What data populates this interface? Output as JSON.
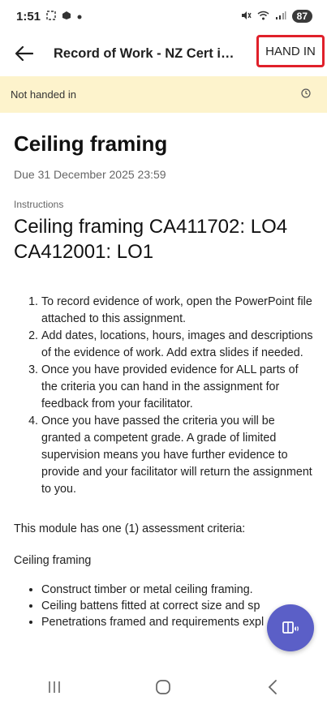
{
  "status_bar": {
    "time": "1:51",
    "battery": "87",
    "icons": [
      "screenshot-icon",
      "cloud-icon",
      "dot-icon",
      "mute-icon",
      "wifi-icon",
      "signal-icon"
    ]
  },
  "app_bar": {
    "title": "Record of Work - NZ Cert in Ca...",
    "hand_in_label": "HAND IN",
    "highlight_color": "#e0202a"
  },
  "banner": {
    "status": "Not handed in",
    "background": "#fdf3cc"
  },
  "assignment": {
    "title": "Ceiling framing",
    "due": "Due 31 December 2025 23:59",
    "instructions_label": "Instructions",
    "instructions_heading": "Ceiling framing CA411702: LO4 CA412001: LO1",
    "steps": [
      "To record evidence of work, open the PowerPoint file attached to this assignment.",
      "Add dates, locations, hours, images and descriptions of the evidence of work. Add extra slides if needed.",
      "Once you have provided evidence for ALL parts of the criteria you can hand in the assignment for feedback from your facilitator.",
      "Once you have passed the criteria you will be granted a competent grade. A grade of limited supervision means you have further evidence to provide and your facilitator will return the assignment to you."
    ],
    "module_text": "This module has one (1) assessment criteria:",
    "criteria_title": "Ceiling framing",
    "criteria": [
      "Construct timber or metal ceiling framing.",
      "Ceiling battens fitted at correct size and sp",
      "Penetrations framed and requirements expl"
    ]
  },
  "fab": {
    "icon": "immersive-reader-icon",
    "color": "#5b5fc7"
  },
  "nav_bar": {
    "icons": [
      "recents-icon",
      "home-icon",
      "back-nav-icon"
    ]
  }
}
